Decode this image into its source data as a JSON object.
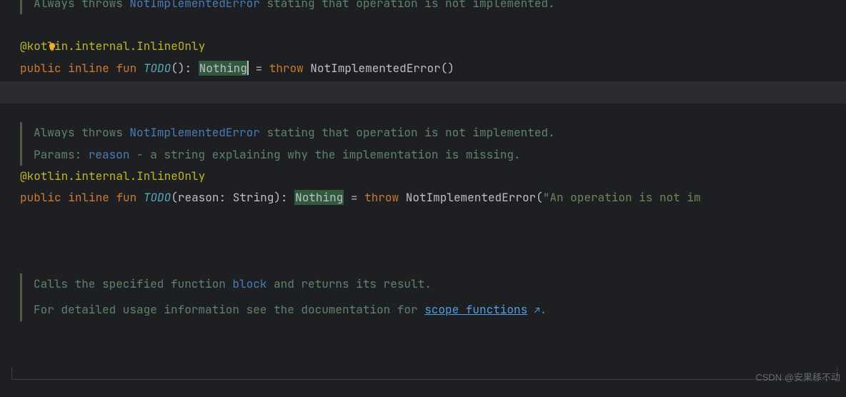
{
  "docs": {
    "block1": {
      "always_throws": "Always throws ",
      "link1": "NotImplementedError",
      "after_link1": " stating that operation is not implemented."
    },
    "block2": {
      "always_throws": "Always throws ",
      "link1": "NotImplementedError",
      "after_link1": " stating that operation is not implemented.",
      "params_label": "Params: ",
      "params_name": "reason",
      "params_desc": " - a string explaining why the implementation is missing."
    },
    "block3": {
      "calls_pre": "Calls the specified function ",
      "calls_link": "block",
      "calls_post": " and returns its result.",
      "detail_pre": "For detailed usage information see the documentation for ",
      "detail_link": "scope functions",
      "detail_post": "."
    }
  },
  "code": {
    "annotation": "@kotlin.internal.InlineOnly",
    "todo1": {
      "kw_public": "public",
      "kw_inline": "inline",
      "kw_fun": "fun",
      "fn_name": "TODO",
      "parens": "()",
      "colon": ": ",
      "ret_type": "Nothing",
      "equals": " = ",
      "kw_throw": "throw",
      "call": " NotImplementedError()"
    },
    "todo2": {
      "kw_public": "public",
      "kw_inline": "inline",
      "kw_fun": "fun",
      "fn_name": "TODO",
      "open_paren": "(",
      "param_name": "reason",
      "param_colon": ": ",
      "param_type": "String",
      "close_paren": ")",
      "colon": ": ",
      "ret_type": "Nothing",
      "equals": " = ",
      "kw_throw": "throw",
      "call_pre": " NotImplementedError(",
      "str": "\"An operation is not im",
      "call_post": ""
    }
  },
  "icons": {
    "bulb": "intention-bulb-icon",
    "arrow": "↗"
  },
  "watermark": "CSDN @安果移不动"
}
